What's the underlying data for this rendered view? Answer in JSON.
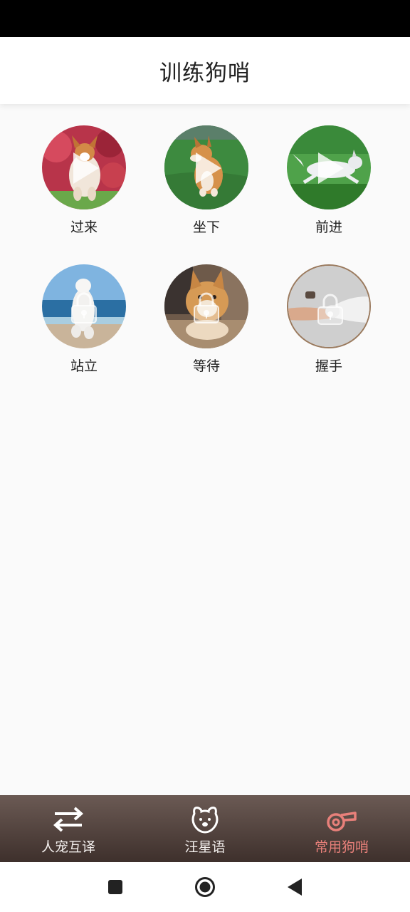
{
  "header": {
    "title": "训练狗哨"
  },
  "commands": [
    {
      "label": "过来",
      "photo": "corgi-running-photo",
      "overlay": "play-icon"
    },
    {
      "label": "坐下",
      "photo": "shiba-sitting-photo",
      "overlay": "play-icon"
    },
    {
      "label": "前进",
      "photo": "husky-running-photo",
      "overlay": "play-icon"
    },
    {
      "label": "站立",
      "photo": "dog-standing-beach-photo",
      "overlay": "lock-icon"
    },
    {
      "label": "等待",
      "photo": "akita-lying-photo",
      "overlay": "lock-icon"
    },
    {
      "label": "握手",
      "photo": "paw-shake-photo",
      "overlay": "lock-icon"
    }
  ],
  "bottom_nav": {
    "items": [
      {
        "label": "人宠互译",
        "icon": "swap-arrows-icon"
      },
      {
        "label": "汪星语",
        "icon": "dog-face-icon"
      },
      {
        "label": "常用狗哨",
        "icon": "whistle-icon",
        "active": true
      }
    ]
  },
  "system_nav": [
    "recents-square-icon",
    "home-circle-icon",
    "back-triangle-icon"
  ],
  "colors": {
    "nav_bg": "#4f403b",
    "active": "#e8807a",
    "status_bar": "#000000"
  }
}
